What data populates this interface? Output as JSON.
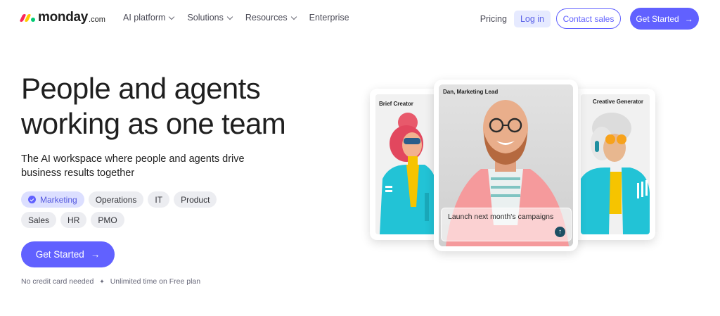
{
  "nav": {
    "logo_word": "monday",
    "logo_suffix": ".com",
    "menu": [
      {
        "label": "AI platform",
        "has_dropdown": true
      },
      {
        "label": "Solutions",
        "has_dropdown": true
      },
      {
        "label": "Resources",
        "has_dropdown": true
      },
      {
        "label": "Enterprise",
        "has_dropdown": false
      }
    ],
    "pricing": "Pricing",
    "login": "Log in",
    "contact_sales": "Contact sales",
    "get_started": "Get Started",
    "arrow_icon": "arrow-right-icon"
  },
  "hero": {
    "title_line1": "People and agents",
    "title_line2": "working as one team",
    "subtitle": "The AI workspace where people and agents drive business results together",
    "chips_row1": [
      "Marketing",
      "Operations",
      "IT",
      "Product"
    ],
    "chips_row2": [
      "Sales",
      "HR",
      "PMO"
    ],
    "active_chip": "Marketing",
    "cta": "Get Started",
    "note_part1": "No credit card needed",
    "note_separator": "✦",
    "note_part2": "Unlimited time on Free plan"
  },
  "cards": {
    "left_label": "Brief Creator",
    "center_label": "Dan, Marketing Lead",
    "right_label": "Creative Generator",
    "prompt": "Launch next month's campaigns",
    "send_icon": "arrow-up-icon"
  },
  "colors": {
    "brand": "#6161ff",
    "logo_red": "#fb275d",
    "logo_yellow": "#ffcb00",
    "logo_green": "#00ca72",
    "text": "#1f1f1f"
  }
}
